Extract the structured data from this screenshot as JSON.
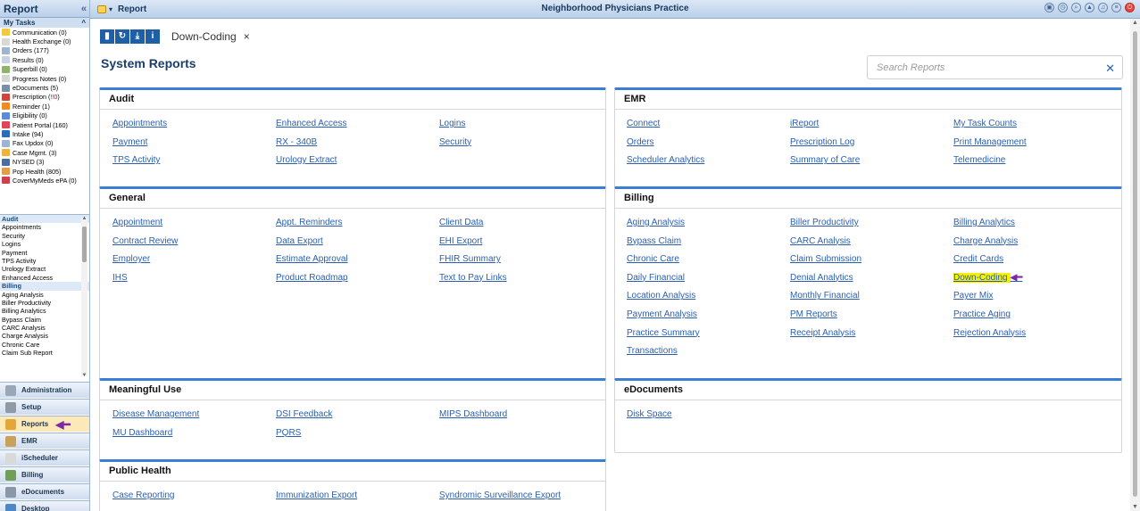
{
  "sidebar": {
    "title": "Report",
    "collapse": "«",
    "tasks_title": "My Tasks",
    "tasks_toggle": "^",
    "tasks": [
      {
        "label": "Communication (0)",
        "color": "#f4c842"
      },
      {
        "label": "Health Exchange (0)",
        "color": "#d9d9d9"
      },
      {
        "label": "Orders (177)",
        "color": "#9fb4cf"
      },
      {
        "label": "Results (0)",
        "color": "#c7d3e2"
      },
      {
        "label": "Superbill (0)",
        "color": "#8fb36b"
      },
      {
        "label": "Progress Notes (0)",
        "color": "#d6d6d6"
      },
      {
        "label": "eDocuments (5)",
        "color": "#7a8ea9"
      },
      {
        "label": "Prescription (",
        "red": "!!0",
        "tail": ")",
        "color": "#d2453a"
      },
      {
        "label": "Reminder (1)",
        "color": "#f08a24"
      },
      {
        "label": "Eligibility (0)",
        "color": "#5b8bd4"
      },
      {
        "label": "Patient Portal (160)",
        "color": "#e0465a"
      },
      {
        "label": "Intake (94)",
        "color": "#2d6db8"
      },
      {
        "label": "Fax Updox (0)",
        "color": "#9cb4d6"
      },
      {
        "label": "Case Mgmt. (3)",
        "color": "#f2b13b"
      },
      {
        "label": "NYSED (3)",
        "color": "#4a6e9e"
      },
      {
        "label": "Pop Health (805)",
        "color": "#e59a4c"
      },
      {
        "label": "CoverMyMeds ePA (0)",
        "color": "#d13f4e"
      }
    ],
    "tree": [
      {
        "label": "Audit",
        "header": true
      },
      {
        "label": "Appointments"
      },
      {
        "label": "Security"
      },
      {
        "label": "Logins"
      },
      {
        "label": "Payment"
      },
      {
        "label": "TPS Activity"
      },
      {
        "label": "Urology Extract"
      },
      {
        "label": "Enhanced Access"
      },
      {
        "label": "Billing",
        "header": true
      },
      {
        "label": "Aging Analysis"
      },
      {
        "label": "Biller Productivity"
      },
      {
        "label": "Billing Analytics"
      },
      {
        "label": "Bypass Claim"
      },
      {
        "label": "CARC Analysis"
      },
      {
        "label": "Charge Analysis"
      },
      {
        "label": "Chronic Care"
      },
      {
        "label": "Claim Sub Report"
      }
    ],
    "nav": [
      {
        "label": "Administration",
        "color": "#9aa7b8",
        "name": "nav-administration"
      },
      {
        "label": "Setup",
        "color": "#8f9aa8",
        "name": "nav-setup"
      },
      {
        "label": "Reports",
        "color": "#e3a63a",
        "name": "nav-reports",
        "active": true
      },
      {
        "label": "EMR",
        "color": "#c9a15a",
        "name": "nav-emr"
      },
      {
        "label": "iScheduler",
        "color": "#d9d9d9",
        "name": "nav-ischeduler"
      },
      {
        "label": "Billing",
        "color": "#6f9f5a",
        "name": "nav-billing"
      },
      {
        "label": "eDocuments",
        "color": "#8a97a8",
        "name": "nav-edocuments"
      },
      {
        "label": "Desktop",
        "color": "#4f86c6",
        "name": "nav-desktop"
      }
    ],
    "arrow": "◀━"
  },
  "topbar": {
    "title": "Report",
    "dropdown": "▾",
    "center": "Neighborhood Physicians Practice"
  },
  "tab": {
    "name": "Down-Coding",
    "close": "×",
    "tools": [
      "▮",
      "↻",
      "⤓",
      "i"
    ]
  },
  "page_title": "System Reports",
  "search": {
    "placeholder": "Search Reports",
    "clear": "✕"
  },
  "cards": [
    {
      "title": "Audit",
      "links": [
        [
          "Appointments",
          "Enhanced Access",
          "Logins"
        ],
        [
          "Payment",
          "RX - 340B",
          "Security"
        ],
        [
          "TPS Activity",
          "Urology Extract",
          ""
        ]
      ]
    },
    {
      "title": "EMR",
      "links": [
        [
          "Connect",
          "iReport",
          "My Task Counts"
        ],
        [
          "Orders",
          "Prescription Log",
          "Print Management"
        ],
        [
          "Scheduler Analytics",
          "Summary of Care",
          "Telemedicine"
        ]
      ]
    },
    {
      "title": "General",
      "links": [
        [
          "Appointment",
          "Appt. Reminders",
          "Client Data"
        ],
        [
          "Contract Review",
          "Data Export",
          "EHI Export"
        ],
        [
          "Employer",
          "Estimate Approval",
          "FHIR Summary"
        ],
        [
          "IHS",
          "Product Roadmap",
          "Text to Pay Links"
        ]
      ]
    },
    {
      "title": "Billing",
      "links": [
        [
          "Aging Analysis",
          "Biller Productivity",
          "Billing Analytics"
        ],
        [
          "Bypass Claim",
          "CARC Analysis",
          "Charge Analysis"
        ],
        [
          "Chronic Care",
          "Claim Submission",
          "Credit Cards"
        ],
        [
          "Daily Financial",
          "Denial Analytics",
          "Down-Coding"
        ],
        [
          "Location Analysis",
          "Monthly Financial",
          "Payer Mix"
        ],
        [
          "Payment Analysis",
          "PM Reports",
          "Practice Aging"
        ],
        [
          "Practice Summary",
          "Receipt Analysis",
          "Rejection Analysis"
        ],
        [
          "Transactions",
          "",
          ""
        ]
      ]
    },
    {
      "title": "Meaningful Use",
      "links": [
        [
          "Disease Management",
          "DSI Feedback",
          "MIPS Dashboard"
        ],
        [
          "MU Dashboard",
          "PQRS",
          ""
        ]
      ]
    },
    {
      "title": "eDocuments",
      "links": [
        [
          "Disk Space",
          "",
          ""
        ]
      ]
    },
    {
      "title": "Public Health",
      "links": [
        [
          "Case Reporting",
          "Immunization Export",
          "Syndromic Surveillance Export"
        ]
      ]
    }
  ],
  "highlight_link": "Down-Coding",
  "highlight_arrow": "◀━"
}
